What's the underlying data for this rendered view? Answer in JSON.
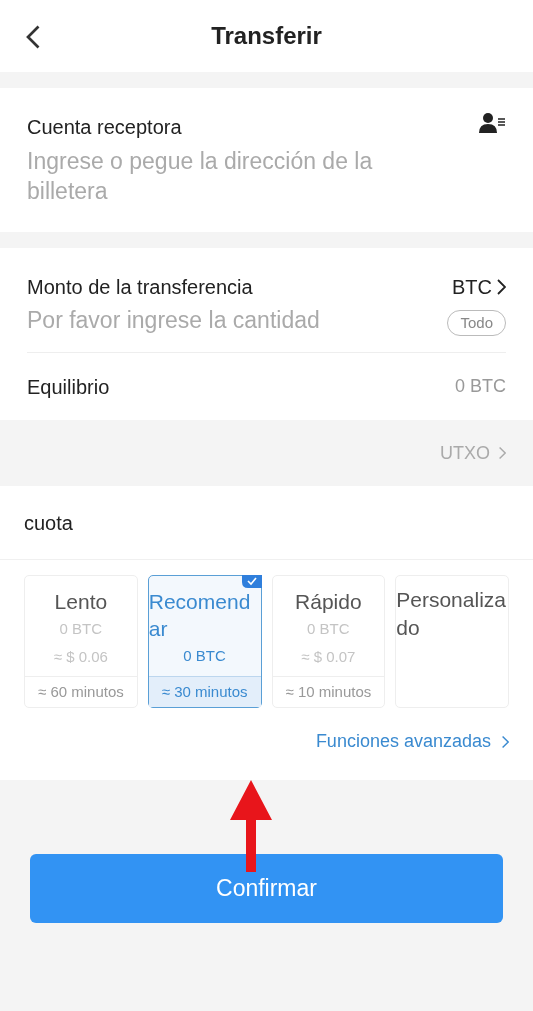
{
  "header": {
    "title": "Transferir"
  },
  "recipient": {
    "label": "Cuenta receptora",
    "placeholder": "Ingrese o pegue la dirección de la billetera"
  },
  "amount": {
    "label": "Monto de la transferencia",
    "currency": "BTC",
    "placeholder": "Por favor ingrese la cantidad",
    "all_button": "Todo"
  },
  "balance": {
    "label": "Equilibrio",
    "value": "0 BTC"
  },
  "utxo": "UTXO",
  "fee": {
    "label": "cuota",
    "options": [
      {
        "kind": "tier",
        "name": "Lento",
        "btc": "0 BTC",
        "usd": "≈ $ 0.06",
        "time": "≈ 60 minutos",
        "selected": false
      },
      {
        "kind": "tier",
        "name": "Recomendar",
        "btc": "0 BTC",
        "time": "≈ 30 minutos",
        "selected": true
      },
      {
        "kind": "tier",
        "name": "Rápido",
        "btc": "0 BTC",
        "usd": "≈ $ 0.07",
        "time": "≈ 10 minutos",
        "selected": false
      },
      {
        "kind": "custom",
        "name": "Personalizado",
        "selected": false
      }
    ],
    "advanced": "Funciones avanzadas"
  },
  "confirm_button": "Confirmar"
}
